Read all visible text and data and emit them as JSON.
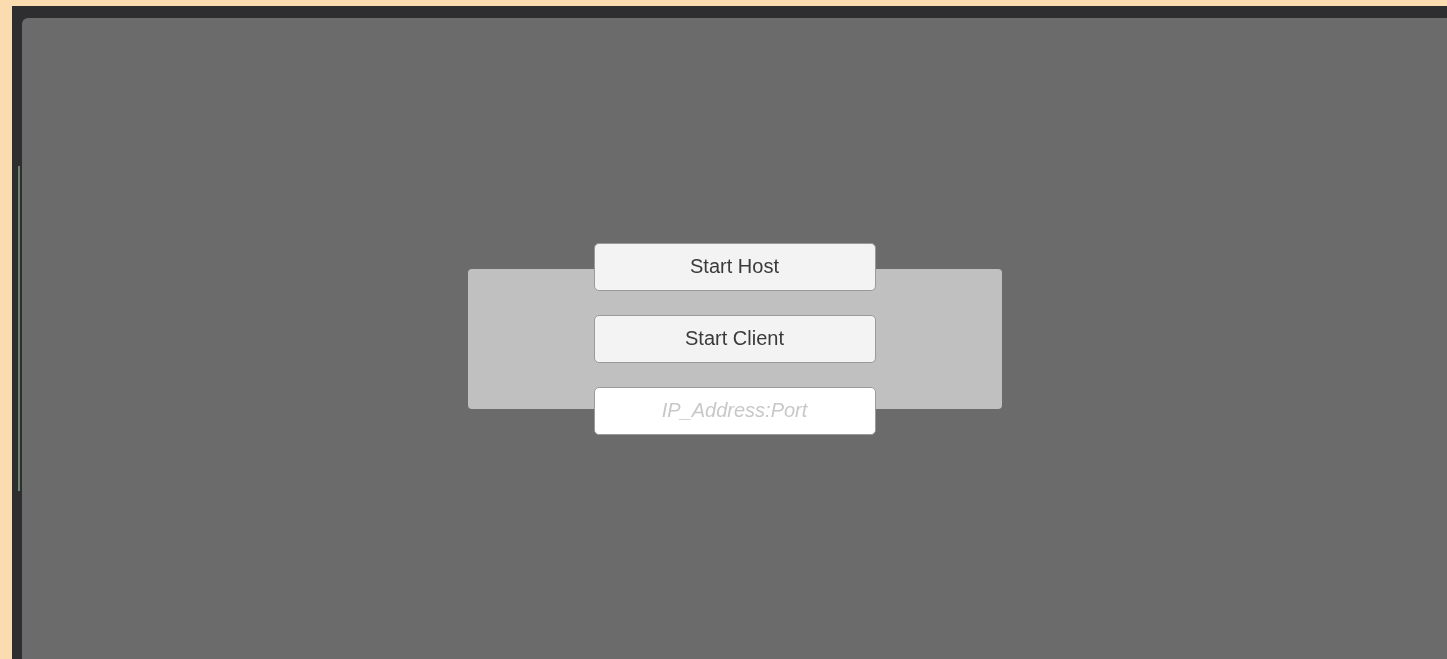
{
  "menu": {
    "buttons": [
      {
        "label": "Start Host"
      },
      {
        "label": "Start Client"
      }
    ],
    "address_field": {
      "placeholder": "IP_Address:Port"
    }
  }
}
